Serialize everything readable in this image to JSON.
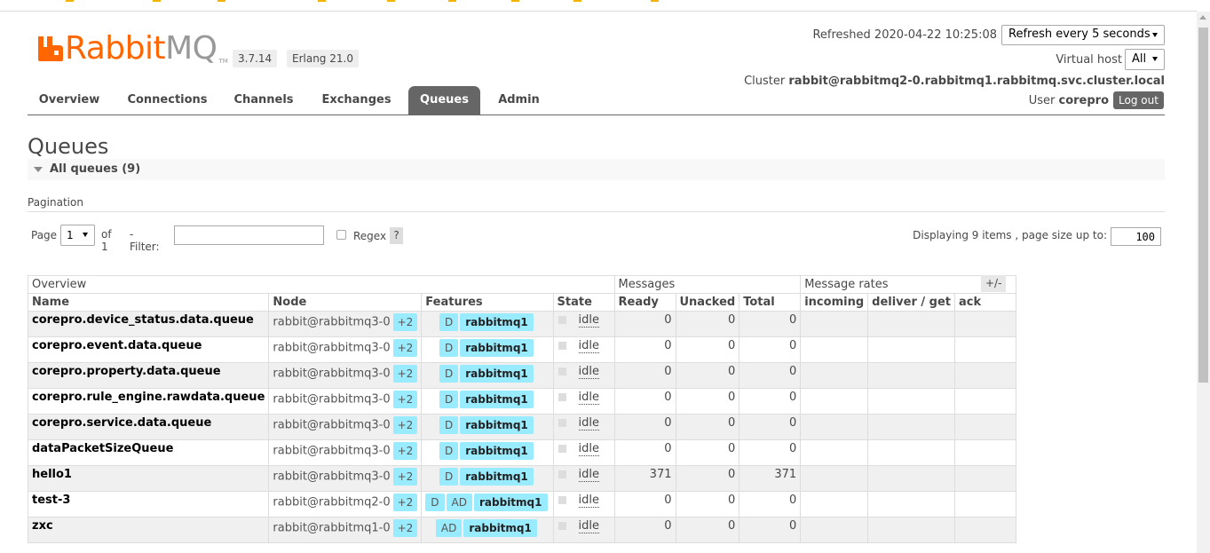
{
  "logo": {
    "brand_a": "Rabbit",
    "brand_b": "MQ",
    "tm": "TM"
  },
  "versions": {
    "rabbitmq": "3.7.14",
    "erlang": "Erlang 21.0"
  },
  "header": {
    "refreshed_label": "Refreshed",
    "refreshed_time": "2020-04-22 10:25:08",
    "refresh_select": "Refresh every 5 seconds",
    "vhost_label": "Virtual host",
    "vhost_value": "All",
    "cluster_label": "Cluster",
    "cluster_name": "rabbit@rabbitmq2-0.rabbitmq1.rabbitmq.svc.cluster.local",
    "user_label": "User",
    "user_name": "corepro",
    "logout_label": "Log out"
  },
  "tabs": [
    {
      "label": "Overview",
      "active": false
    },
    {
      "label": "Connections",
      "active": false
    },
    {
      "label": "Channels",
      "active": false
    },
    {
      "label": "Exchanges",
      "active": false
    },
    {
      "label": "Queues",
      "active": true
    },
    {
      "label": "Admin",
      "active": false
    }
  ],
  "page": {
    "title": "Queues",
    "section_title": "All queues (9)",
    "pagination_label": "Pagination"
  },
  "pager": {
    "page_label": "Page",
    "page_value": "1",
    "of_label": "of 1",
    "filter_label": "- Filter:",
    "filter_value": "",
    "regex_label": "Regex",
    "regex_help": "?",
    "displaying": "Displaying 9 items , page size up to:",
    "page_size": "100"
  },
  "table": {
    "groups": {
      "overview": "Overview",
      "messages": "Messages",
      "rates": "Message rates"
    },
    "columns": {
      "name": "Name",
      "node": "Node",
      "features": "Features",
      "state": "State",
      "ready": "Ready",
      "unacked": "Unacked",
      "total": "Total",
      "incoming": "incoming",
      "deliver_get": "deliver / get",
      "ack": "ack"
    },
    "toggle": "+/-",
    "rows": [
      {
        "name": "corepro.device_status.data.queue",
        "node": "rabbit@rabbitmq3-0",
        "plus": "+2",
        "features": [
          "D"
        ],
        "policy": "rabbitmq1",
        "state": "idle",
        "ready": "0",
        "unacked": "0",
        "total": "0"
      },
      {
        "name": "corepro.event.data.queue",
        "node": "rabbit@rabbitmq3-0",
        "plus": "+2",
        "features": [
          "D"
        ],
        "policy": "rabbitmq1",
        "state": "idle",
        "ready": "0",
        "unacked": "0",
        "total": "0"
      },
      {
        "name": "corepro.property.data.queue",
        "node": "rabbit@rabbitmq3-0",
        "plus": "+2",
        "features": [
          "D"
        ],
        "policy": "rabbitmq1",
        "state": "idle",
        "ready": "0",
        "unacked": "0",
        "total": "0"
      },
      {
        "name": "corepro.rule_engine.rawdata.queue",
        "node": "rabbit@rabbitmq3-0",
        "plus": "+2",
        "features": [
          "D"
        ],
        "policy": "rabbitmq1",
        "state": "idle",
        "ready": "0",
        "unacked": "0",
        "total": "0"
      },
      {
        "name": "corepro.service.data.queue",
        "node": "rabbit@rabbitmq3-0",
        "plus": "+2",
        "features": [
          "D"
        ],
        "policy": "rabbitmq1",
        "state": "idle",
        "ready": "0",
        "unacked": "0",
        "total": "0"
      },
      {
        "name": "dataPacketSizeQueue",
        "node": "rabbit@rabbitmq3-0",
        "plus": "+2",
        "features": [
          "D"
        ],
        "policy": "rabbitmq1",
        "state": "idle",
        "ready": "0",
        "unacked": "0",
        "total": "0"
      },
      {
        "name": "hello1",
        "node": "rabbit@rabbitmq3-0",
        "plus": "+2",
        "features": [
          "D"
        ],
        "policy": "rabbitmq1",
        "state": "idle",
        "ready": "371",
        "unacked": "0",
        "total": "371"
      },
      {
        "name": "test-3",
        "node": "rabbit@rabbitmq2-0",
        "plus": "+2",
        "features": [
          "D",
          "AD"
        ],
        "policy": "rabbitmq1",
        "state": "idle",
        "ready": "0",
        "unacked": "0",
        "total": "0"
      },
      {
        "name": "zxc",
        "node": "rabbit@rabbitmq1-0",
        "plus": "+2",
        "features": [
          "AD"
        ],
        "policy": "rabbitmq1",
        "state": "idle",
        "ready": "0",
        "unacked": "0",
        "total": "0"
      }
    ]
  },
  "colors": {
    "brand_orange": "#ff6600",
    "tab_active": "#666666",
    "feature_badge": "#99ebff"
  }
}
